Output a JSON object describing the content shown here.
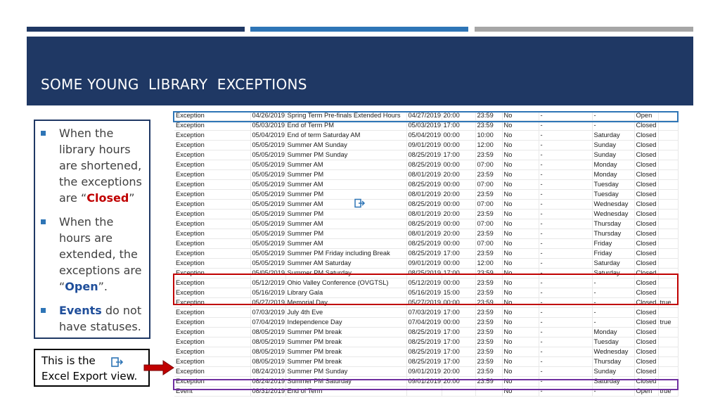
{
  "slide": {
    "title": "SOME YOUNG  LIBRARY  EXCEPTIONS",
    "accent_colors": [
      "#1f3864",
      "#2e75b6",
      "#a6a6a6"
    ]
  },
  "notes": {
    "b1_text": "When the library hours are shortened, the exceptions are “",
    "b1_strong": "Closed",
    "b1_end": "”",
    "b2_text": "When the hours are extended, the exceptions are “",
    "b2_strong": "Open",
    "b2_end": "”.",
    "b3_strong": "Events",
    "b3_text": " do not have statuses."
  },
  "callout": {
    "line1": "This is the",
    "line2": "Excel Export view.",
    "icon": "export-icon"
  },
  "sheet": {
    "rows": [
      [
        "Exception",
        "04/26/2019",
        "Spring Term Pre-finals Extended Hours",
        "04/27/2019",
        "20:00",
        "23:59",
        "No",
        "-",
        "-",
        "Open",
        ""
      ],
      [
        "Exception",
        "05/03/2019",
        "End of Term PM",
        "05/03/2019",
        "17:00",
        "23:59",
        "No",
        "-",
        "-",
        "Closed",
        ""
      ],
      [
        "Exception",
        "05/04/2019",
        "End of term Saturday AM",
        "05/04/2019",
        "00:00",
        "10:00",
        "No",
        "-",
        "Saturday",
        "Closed",
        ""
      ],
      [
        "Exception",
        "05/05/2019",
        "Summer AM Sunday",
        "09/01/2019",
        "00:00",
        "12:00",
        "No",
        "-",
        "Sunday",
        "Closed",
        ""
      ],
      [
        "Exception",
        "05/05/2019",
        "Summer PM Sunday",
        "08/25/2019",
        "17:00",
        "23:59",
        "No",
        "-",
        "Sunday",
        "Closed",
        ""
      ],
      [
        "Exception",
        "05/05/2019",
        "Summer AM",
        "08/25/2019",
        "00:00",
        "07:00",
        "No",
        "-",
        "Monday",
        "Closed",
        ""
      ],
      [
        "Exception",
        "05/05/2019",
        "Summer PM",
        "08/01/2019",
        "20:00",
        "23:59",
        "No",
        "-",
        "Monday",
        "Closed",
        ""
      ],
      [
        "Exception",
        "05/05/2019",
        "Summer AM",
        "08/25/2019",
        "00:00",
        "07:00",
        "No",
        "-",
        "Tuesday",
        "Closed",
        ""
      ],
      [
        "Exception",
        "05/05/2019",
        "Summer PM",
        "08/01/2019",
        "20:00",
        "23:59",
        "No",
        "-",
        "Tuesday",
        "Closed",
        ""
      ],
      [
        "Exception",
        "05/05/2019",
        "Summer AM",
        "08/25/2019",
        "00:00",
        "07:00",
        "No",
        "-",
        "Wednesday",
        "Closed",
        ""
      ],
      [
        "Exception",
        "05/05/2019",
        "Summer PM",
        "08/01/2019",
        "20:00",
        "23:59",
        "No",
        "-",
        "Wednesday",
        "Closed",
        ""
      ],
      [
        "Exception",
        "05/05/2019",
        "Summer AM",
        "08/25/2019",
        "00:00",
        "07:00",
        "No",
        "-",
        "Thursday",
        "Closed",
        ""
      ],
      [
        "Exception",
        "05/05/2019",
        "Summer PM",
        "08/01/2019",
        "20:00",
        "23:59",
        "No",
        "-",
        "Thursday",
        "Closed",
        ""
      ],
      [
        "Exception",
        "05/05/2019",
        "Summer AM",
        "08/25/2019",
        "00:00",
        "07:00",
        "No",
        "-",
        "Friday",
        "Closed",
        ""
      ],
      [
        "Exception",
        "05/05/2019",
        "Summer PM Friday including Break",
        "08/25/2019",
        "17:00",
        "23:59",
        "No",
        "-",
        "Friday",
        "Closed",
        ""
      ],
      [
        "Exception",
        "05/05/2019",
        "Summer AM Saturday",
        "09/01/2019",
        "00:00",
        "12:00",
        "No",
        "-",
        "Saturday",
        "Closed",
        ""
      ],
      [
        "Exception",
        "05/05/2019",
        "Summer PM Saturday",
        "08/25/2019",
        "17:00",
        "23:59",
        "No",
        "-",
        "Saturday",
        "Closed",
        ""
      ],
      [
        "Exception",
        "05/12/2019",
        "Ohio Valley Conference (OVGTSL)",
        "05/12/2019",
        "00:00",
        "23:59",
        "No",
        "-",
        "-",
        "Closed",
        ""
      ],
      [
        "Exception",
        "05/16/2019",
        "Library Gala",
        "05/16/2019",
        "15:00",
        "23:59",
        "No",
        "-",
        "-",
        "Closed",
        ""
      ],
      [
        "Exception",
        "05/27/2019",
        "Memorial Day",
        "05/27/2019",
        "00:00",
        "23:59",
        "No",
        "-",
        "-",
        "Closed",
        "true"
      ],
      [
        "Exception",
        "07/03/2019",
        "July 4th Eve",
        "07/03/2019",
        "17:00",
        "23:59",
        "No",
        "-",
        "-",
        "Closed",
        ""
      ],
      [
        "Exception",
        "07/04/2019",
        "Independence Day",
        "07/04/2019",
        "00:00",
        "23:59",
        "No",
        "-",
        "-",
        "Closed",
        "true"
      ],
      [
        "Exception",
        "08/05/2019",
        "Summer PM break",
        "08/25/2019",
        "17:00",
        "23:59",
        "No",
        "-",
        "Monday",
        "Closed",
        ""
      ],
      [
        "Exception",
        "08/05/2019",
        "Summer PM break",
        "08/25/2019",
        "17:00",
        "23:59",
        "No",
        "-",
        "Tuesday",
        "Closed",
        ""
      ],
      [
        "Exception",
        "08/05/2019",
        "Summer PM break",
        "08/25/2019",
        "17:00",
        "23:59",
        "No",
        "-",
        "Wednesday",
        "Closed",
        ""
      ],
      [
        "Exception",
        "08/05/2019",
        "Summer PM break",
        "08/25/2019",
        "17:00",
        "23:59",
        "No",
        "-",
        "Thursday",
        "Closed",
        ""
      ],
      [
        "Exception",
        "08/24/2019",
        "Summer PM Sunday",
        "09/01/2019",
        "20:00",
        "23:59",
        "No",
        "-",
        "Sunday",
        "Closed",
        ""
      ],
      [
        "Exception",
        "08/24/2019",
        "Summer PM Saturday",
        "09/01/2019",
        "20:00",
        "23:59",
        "No",
        "-",
        "Saturday",
        "Closed",
        ""
      ],
      [
        "Event",
        "08/31/2019",
        "End of Term",
        "",
        "",
        "",
        "No",
        "-",
        "-",
        "Open",
        "true"
      ]
    ]
  },
  "highlight_colors": {
    "open_row": "#2e75b6",
    "closed_rows": "#c00000",
    "event_row": "#7030a0",
    "arrow": "#c00000"
  }
}
